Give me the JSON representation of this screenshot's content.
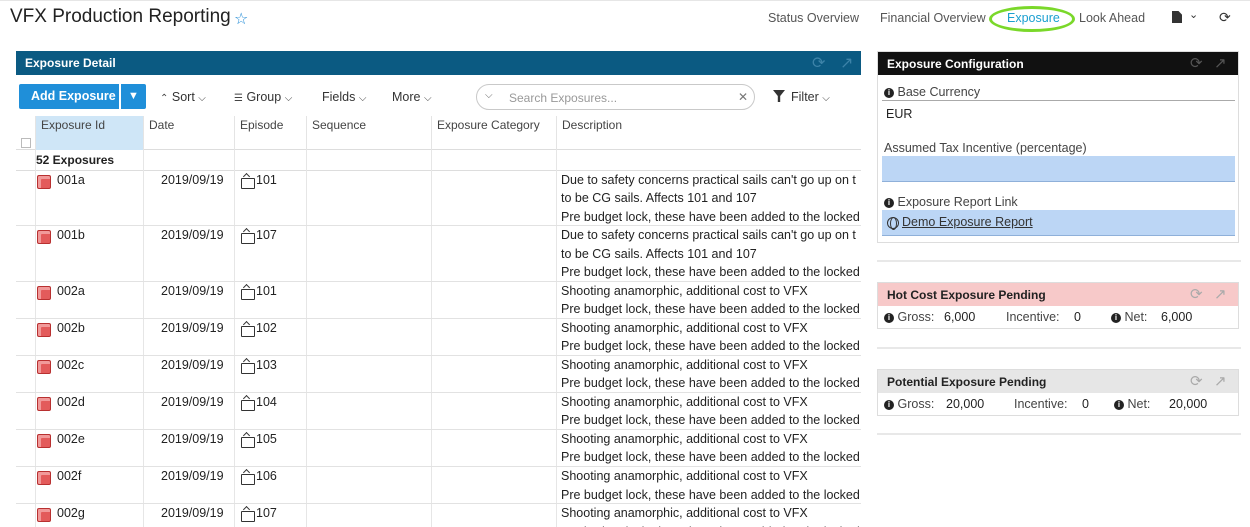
{
  "header": {
    "title": "VFX Production Reporting",
    "star_icon": "star-outline-icon",
    "nav": [
      "Status Overview",
      "Financial Overview",
      "Exposure",
      "Look Ahead"
    ],
    "active_nav": "Exposure",
    "ring_color": "#7ad82a"
  },
  "left": {
    "panel_title": "Exposure Detail",
    "panel_color": "#0b5a82",
    "add_label": "Add Exposure",
    "sort_label": "Sort",
    "group_label": "Group",
    "fields_label": "Fields",
    "more_label": "More",
    "search_placeholder": "Search Exposures...",
    "filter_label": "Filter",
    "columns": [
      "Exposure Id",
      "Date",
      "Episode",
      "Sequence",
      "Exposure Category",
      "Description"
    ],
    "group_label_text": "52 Exposures",
    "rows": [
      {
        "id": "001a",
        "date": "2019/09/19",
        "episode": "101",
        "desc": [
          "Due to safety concerns practical sails can't go up on t",
          "to be CG sails. Affects 101 and 107",
          "Pre budget lock, these have been added to the locked"
        ]
      },
      {
        "id": "001b",
        "date": "2019/09/19",
        "episode": "107",
        "desc": [
          "Due to safety concerns practical sails can't go up on t",
          "to be CG sails. Affects 101 and 107",
          "Pre budget lock, these have been added to the locked"
        ]
      },
      {
        "id": "002a",
        "date": "2019/09/19",
        "episode": "101",
        "desc": [
          "Shooting anamorphic, additional cost to VFX",
          "Pre budget lock, these have been added to the locked"
        ]
      },
      {
        "id": "002b",
        "date": "2019/09/19",
        "episode": "102",
        "desc": [
          "Shooting anamorphic, additional cost to VFX",
          "Pre budget lock, these have been added to the locked"
        ]
      },
      {
        "id": "002c",
        "date": "2019/09/19",
        "episode": "103",
        "desc": [
          "Shooting anamorphic, additional cost to VFX",
          "Pre budget lock, these have been added to the locked"
        ]
      },
      {
        "id": "002d",
        "date": "2019/09/19",
        "episode": "104",
        "desc": [
          "Shooting anamorphic, additional cost to VFX",
          "Pre budget lock, these have been added to the locked"
        ]
      },
      {
        "id": "002e",
        "date": "2019/09/19",
        "episode": "105",
        "desc": [
          "Shooting anamorphic, additional cost to VFX",
          "Pre budget lock, these have been added to the locked"
        ]
      },
      {
        "id": "002f",
        "date": "2019/09/19",
        "episode": "106",
        "desc": [
          "Shooting anamorphic, additional cost to VFX",
          "Pre budget lock, these have been added to the locked"
        ]
      },
      {
        "id": "002g",
        "date": "2019/09/19",
        "episode": "107",
        "desc": [
          "Shooting anamorphic, additional cost to VFX",
          "Pre budget lock, these have been added to the locked"
        ]
      }
    ]
  },
  "config": {
    "title": "Exposure Configuration",
    "base_currency_label": "Base Currency",
    "base_currency_value": "EUR",
    "tax_label": "Assumed Tax Incentive (percentage)",
    "tax_value": "",
    "link_label": "Exposure Report Link",
    "link_text": "Demo Exposure Report"
  },
  "hot": {
    "title": "Hot Cost Exposure Pending",
    "head_color": "#f7c9c9",
    "gross_label": "Gross:",
    "gross": "6,000",
    "incentive_label": "Incentive:",
    "incentive": "0",
    "net_label": "Net:",
    "net": "6,000"
  },
  "potential": {
    "title": "Potential Exposure Pending",
    "head_color": "#e6e6e6",
    "gross_label": "Gross:",
    "gross": "20,000",
    "incentive_label": "Incentive:",
    "incentive": "0",
    "net_label": "Net:",
    "net": "20,000"
  }
}
